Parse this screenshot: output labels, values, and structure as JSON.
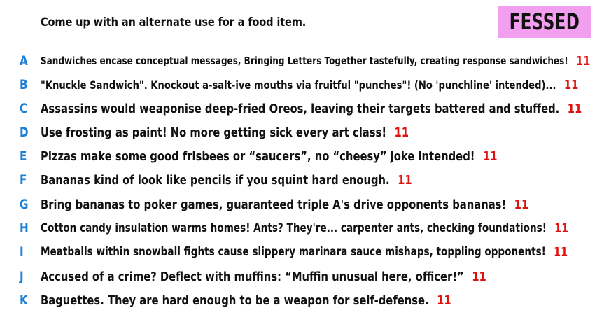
{
  "game": {
    "prompt": "Come up with an alternate use for a food item.",
    "logo_text": "FESSED",
    "logo_color": "#f39ff0",
    "letter_color": "#1e7fd6",
    "score_color": "#e01010"
  },
  "answers": [
    {
      "letter": "A",
      "text": "Sandwiches encase conceptual messages, Bringing Letters Together tastefully, creating response sandwiches!",
      "score": "11"
    },
    {
      "letter": "B",
      "text": "\"Knuckle Sandwich\". Knockout a-salt-ive mouths via fruitful \"punches\"! (No 'punchline' intended)...",
      "score": "11"
    },
    {
      "letter": "C",
      "text": "Assassins would weaponise deep-fried Oreos, leaving their targets battered and stuffed.",
      "score": "11"
    },
    {
      "letter": "D",
      "text": "Use frosting as paint! No more getting sick every art class!",
      "score": "11"
    },
    {
      "letter": "E",
      "text": "Pizzas make some good frisbees or “saucers”, no “cheesy” joke intended!",
      "score": "11"
    },
    {
      "letter": "F",
      "text": "Bananas kind of look like pencils if you squint hard enough.",
      "score": "11"
    },
    {
      "letter": "G",
      "text": "Bring bananas to poker games, guaranteed triple A's drive opponents bananas!",
      "score": "11"
    },
    {
      "letter": "H",
      "text": "Cotton candy insulation warms homes! Ants? They're... carpenter ants, checking foundations!",
      "score": "11"
    },
    {
      "letter": "I",
      "text": "Meatballs within snowball fights cause slippery marinara sauce mishaps, toppling opponents!",
      "score": "11"
    },
    {
      "letter": "J",
      "text": "Accused of a crime? Deflect with muffins: “Muffin unusual here, officer!”",
      "score": "11"
    },
    {
      "letter": "K",
      "text": "Baguettes. They are hard enough to be a weapon for self-defense.",
      "score": "11"
    }
  ]
}
